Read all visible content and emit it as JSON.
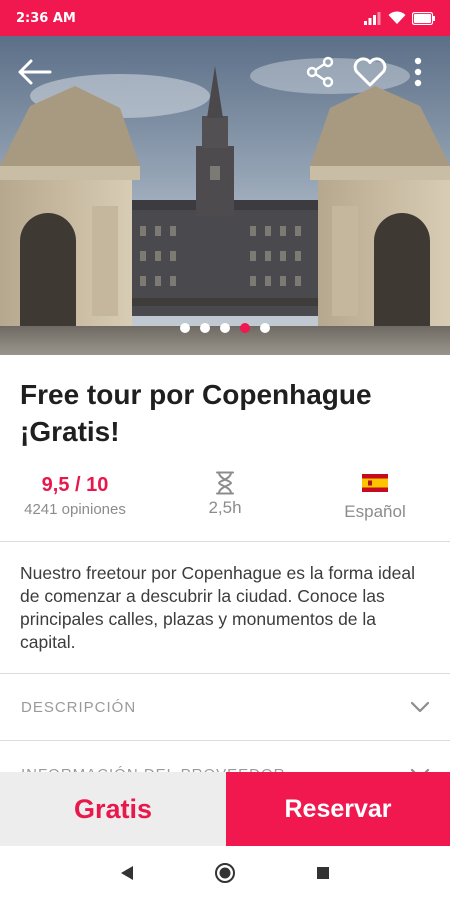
{
  "status_bar": {
    "time": "2:36 AM",
    "icons": [
      "signal-icon",
      "wifi-icon",
      "battery-icon"
    ]
  },
  "header": {
    "icons": [
      "back-arrow-icon",
      "share-icon",
      "heart-icon",
      "more-vert-icon"
    ]
  },
  "gallery": {
    "total_images": 5,
    "active_index": 3
  },
  "tour": {
    "title": "Free tour por Copenhague ¡Gratis!",
    "rating": "9,5 / 10",
    "reviews": "4241 opiniones",
    "duration": "2,5h",
    "language": "Español",
    "description": "Nuestro freetour por Copenhague es la forma ideal de comenzar a descubrir la ciudad. Conoce las principales calles, plazas y monumentos de la capital."
  },
  "sections": [
    {
      "label": "DESCRIPCIÓN"
    },
    {
      "label": "INFORMACIÓN DEL PROVEEDOR"
    }
  ],
  "actions": {
    "price_label": "Gratis",
    "book_label": "Reservar"
  },
  "navigation": {
    "icons": [
      "nav-back-icon",
      "nav-home-icon",
      "nav-recents-icon"
    ]
  },
  "colors": {
    "brand": "#f0184f",
    "rating": "#e8174c",
    "text_dark": "#1f1f1f",
    "text_muted": "#8c8c8c",
    "secondary_button_bg": "#ededed"
  }
}
